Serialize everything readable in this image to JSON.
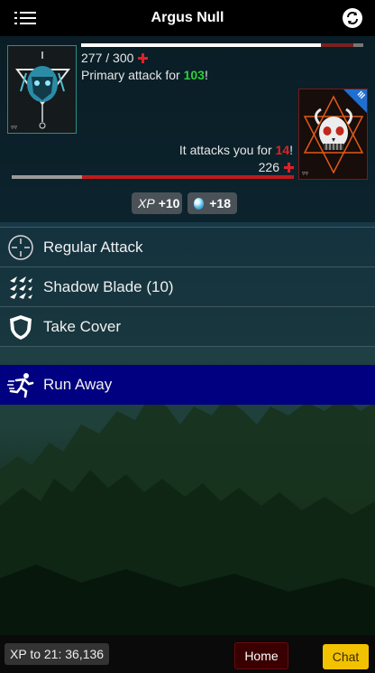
{
  "header": {
    "title": "Argus Null",
    "menu_icon": "menu-icon",
    "refresh_icon": "refresh-icon"
  },
  "player": {
    "hp_current": 277,
    "hp_max": 300,
    "hp_text": "277 / 300",
    "attack_prefix": "Primary attack for ",
    "attack_damage": "103",
    "attack_suffix": "!"
  },
  "enemy": {
    "rank_mark": "III",
    "hp_text": "226",
    "hp_fraction": 0.75,
    "attack_prefix": "It attacks you for ",
    "attack_damage": "14",
    "attack_suffix": "!"
  },
  "rewards": {
    "xp_icon": "XP",
    "xp_gain": "+10",
    "gem_icon": "gem-icon",
    "gem_gain": "+18"
  },
  "actions": [
    {
      "label": "Regular Attack",
      "icon": "crosshair-icon"
    },
    {
      "label": "Shadow Blade (10)",
      "icon": "blade-icon"
    },
    {
      "label": "Take Cover",
      "icon": "shield-icon"
    }
  ],
  "run_away": {
    "label": "Run Away",
    "icon": "running-man-icon"
  },
  "footer": {
    "xp_to_level": "XP to 21: 36,136",
    "home_label": "Home",
    "chat_label": "Chat"
  },
  "colors": {
    "run_away_bg": "#000080",
    "damage_dealt": "#2ccf3b",
    "damage_taken": "#e02222",
    "chat_button": "#f2c200",
    "home_button": "#3a0000"
  }
}
